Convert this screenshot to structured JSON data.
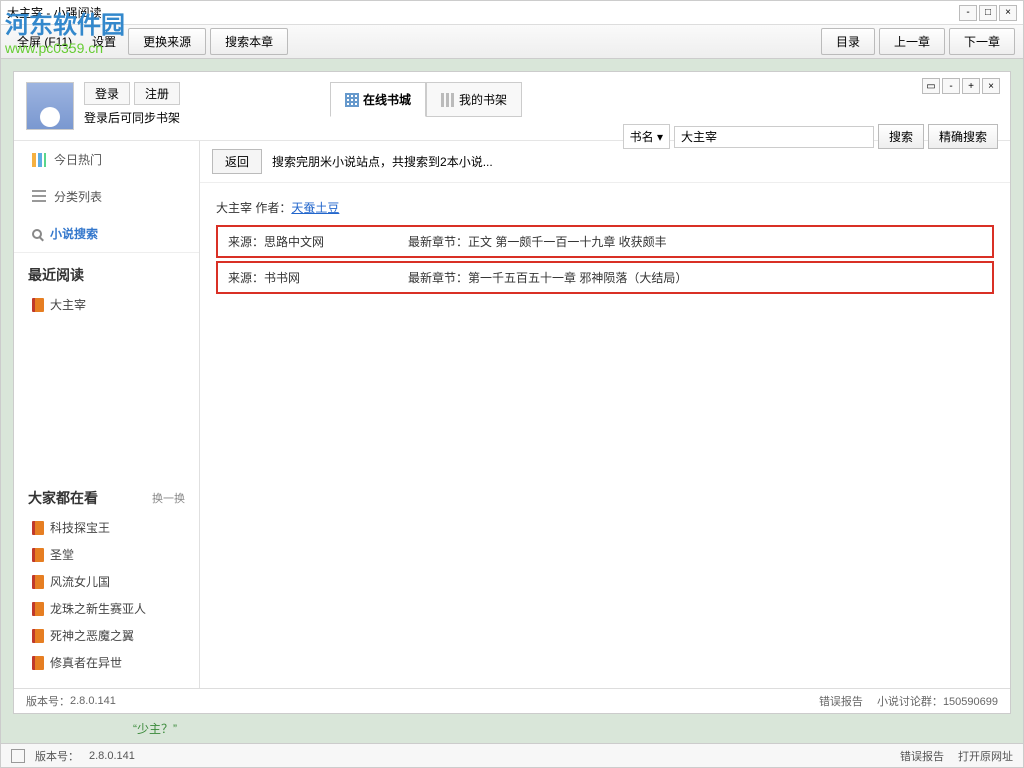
{
  "watermark": {
    "cn": "河东软件园",
    "url": "www.pc0359.cn"
  },
  "outer_window": {
    "title": "大主宰  - 小强阅读",
    "toolbar": {
      "fullscreen": "全屏 (F11)",
      "settings": "设置",
      "change_source": "更换来源",
      "search_chapter": "搜索本章",
      "catalog": "目录",
      "prev": "上一章",
      "next": "下一章"
    }
  },
  "login": {
    "login_btn": "登录",
    "register_btn": "注册",
    "hint": "登录后可同步书架"
  },
  "tabs": {
    "online": "在线书城",
    "myshelf": "我的书架"
  },
  "search": {
    "field_label": "书名",
    "query": "大主宰",
    "btn": "搜索",
    "exact_btn": "精确搜索"
  },
  "sidebar": {
    "nav": {
      "hot": "今日热门",
      "category": "分类列表",
      "search": "小说搜索"
    },
    "recent_title": "最近阅读",
    "recent": [
      "大主宰"
    ],
    "popular_title": "大家都在看",
    "swap": "换一换",
    "popular": [
      "科技探宝王",
      "圣堂",
      "风流女儿国",
      "龙珠之新生赛亚人",
      "死神之恶魔之翼",
      "修真者在异世"
    ]
  },
  "results": {
    "back": "返回",
    "summary": "搜索完朋米小说站点，共搜索到2本小说...",
    "book_label": "大主宰  作者：",
    "author": "天蚕土豆",
    "src_label": "来源：",
    "chap_label": "最新章节：",
    "sources": [
      {
        "name": "思路中文网",
        "chapter": "正文 第一颇千一百一十九章 收获颇丰"
      },
      {
        "name": "书书网",
        "chapter": "第一千五百五十一章 邪神陨落（大结局）"
      }
    ]
  },
  "inner_footer": {
    "version_label": "版本号：",
    "version": "2.8.0.141",
    "bug": "错误报告",
    "group_label": "小说讨论群：",
    "group": "150590699"
  },
  "quote": "“少主？”",
  "outer_footer": {
    "version_label": "版本号：",
    "version": "2.8.0.141",
    "bug": "错误报告",
    "open_url": "打开原网址"
  }
}
